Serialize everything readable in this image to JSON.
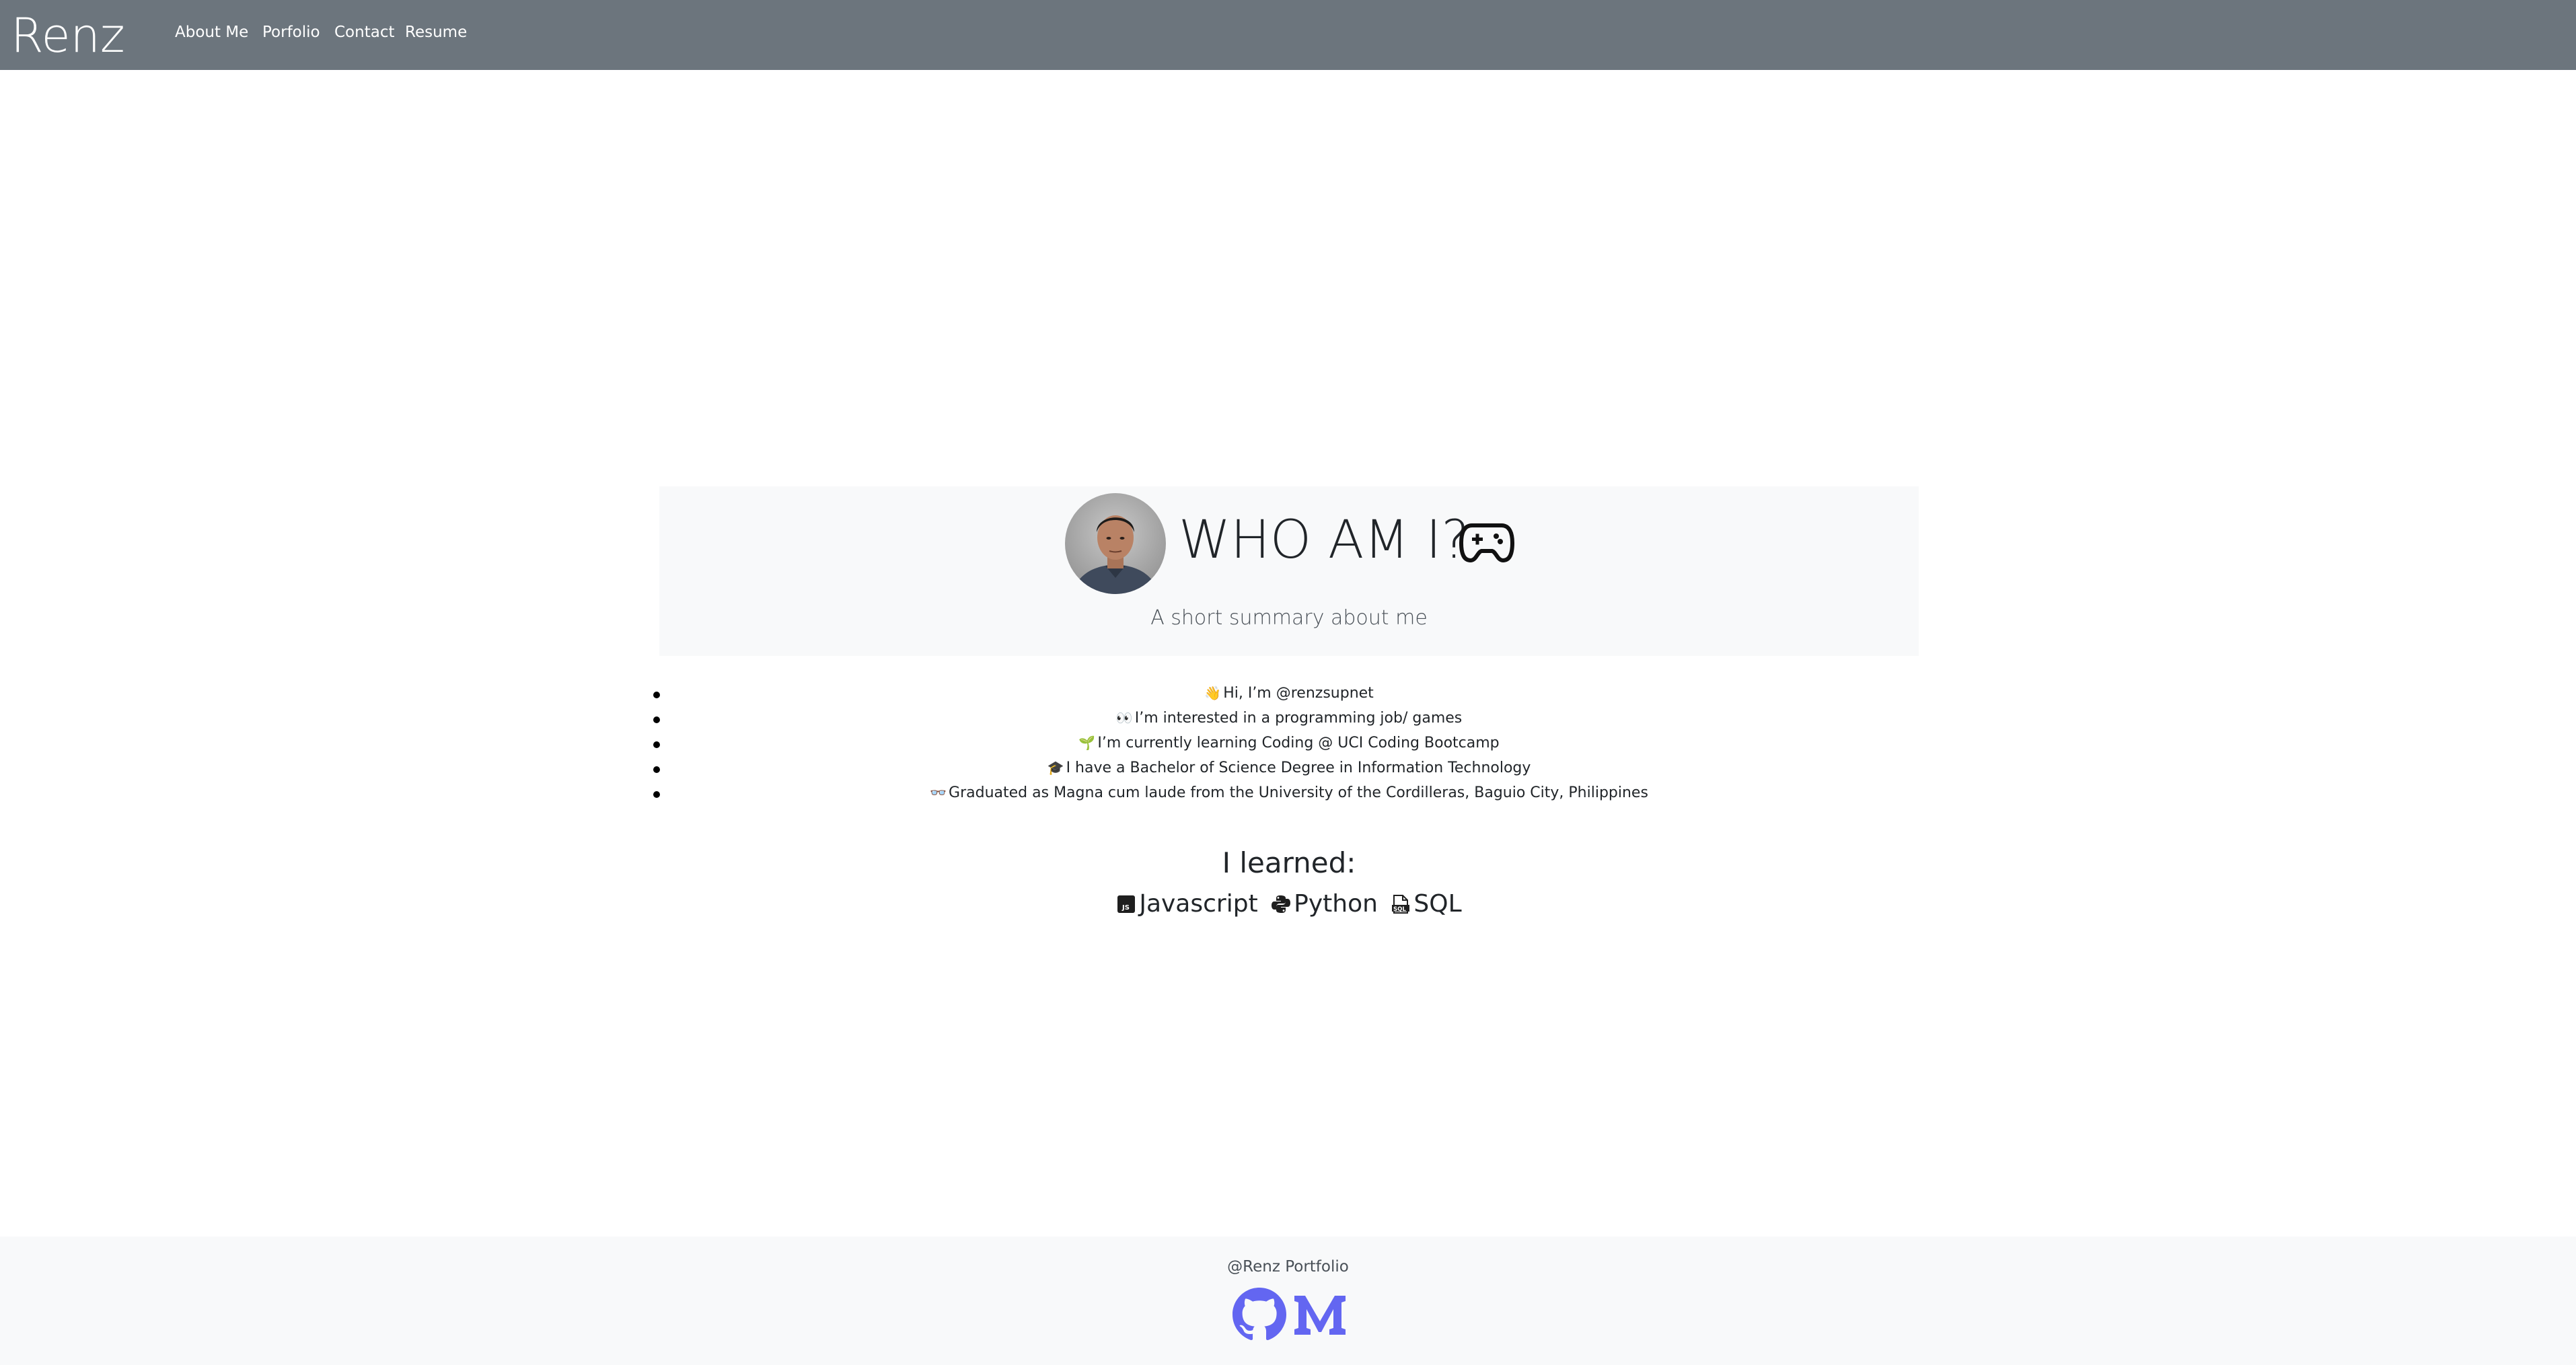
{
  "nav": {
    "brand": "Renz",
    "links": [
      "About Me",
      "Porfolio",
      "Contact",
      "Resume"
    ]
  },
  "hero": {
    "title": "WHO AM I?",
    "subtitle": "A short summary about me"
  },
  "about_items": [
    {
      "emoji": "👋",
      "text": "Hi, I’m @renzsupnet"
    },
    {
      "emoji": "👀",
      "text": "I’m interested in a programming job/ games"
    },
    {
      "emoji": "🌱",
      "text": "I’m currently learning Coding @ UCI Coding Bootcamp"
    },
    {
      "emoji": "🎓",
      "text": "I have a Bachelor of Science Degree in Information Technology"
    },
    {
      "emoji": "👓",
      "text": "Graduated as Magna cum laude from the University of the Cordilleras, Baguio City, Philippines"
    }
  ],
  "learned": {
    "title": "I learned:",
    "skills": [
      "Javascript",
      "Python",
      "SQL"
    ]
  },
  "footer": {
    "text": "@Renz Portfolio"
  },
  "colors": {
    "navbar": "#6c757d",
    "jumbotron": "#f8f9fa",
    "footer": "#f8f9fa",
    "social_icon": "#6366f1"
  }
}
